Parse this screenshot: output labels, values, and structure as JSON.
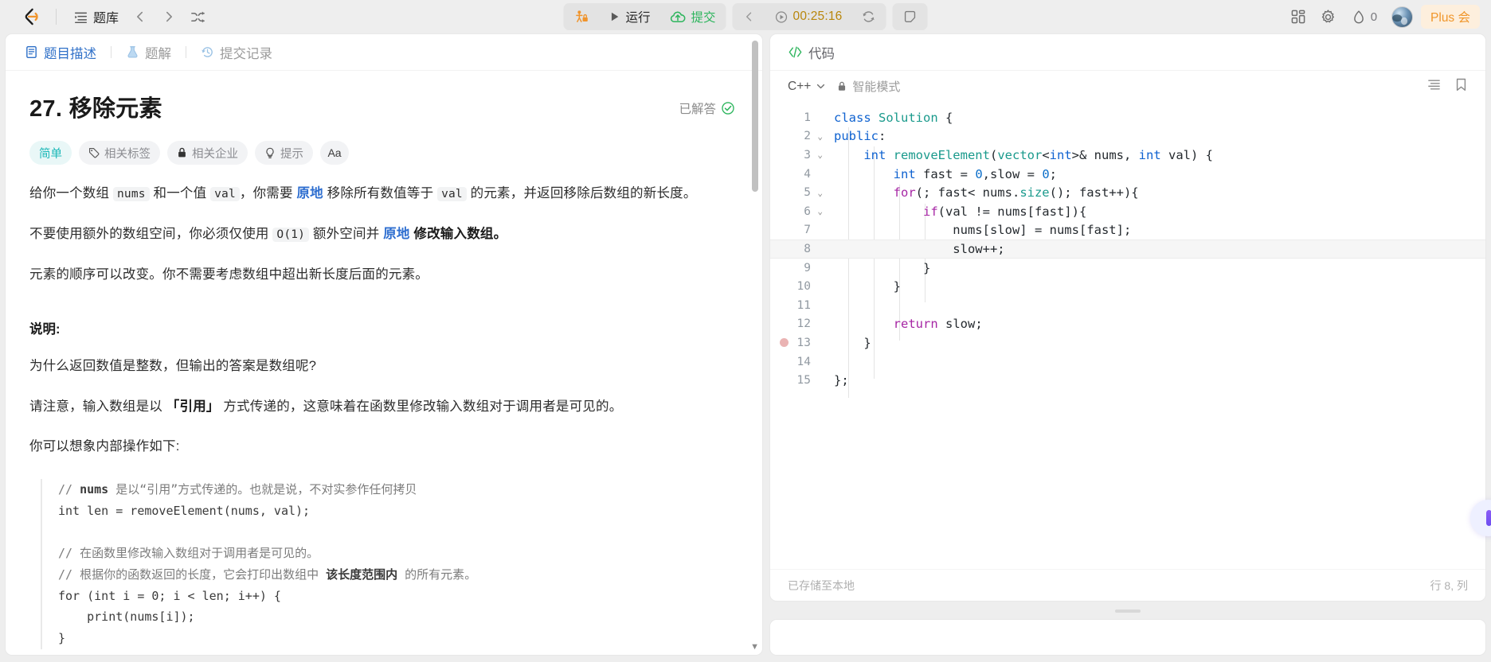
{
  "topnav": {
    "logo_name": "leetcode-logo",
    "problem_list_label": "题库",
    "back_icon": "chevron-left-icon",
    "forward_icon": "chevron-right-icon",
    "shuffle_icon": "shuffle-icon",
    "debug_label": "",
    "run_label": "运行",
    "submit_label": "提交",
    "timer_value": "00:25:16",
    "prev_icon": "chevron-left-icon",
    "play_icon": "play-circle-icon",
    "refresh_icon": "refresh-icon",
    "note_icon": "note-icon",
    "grid_icon": "grid-apps-icon",
    "settings_icon": "gear-icon",
    "streak_icon": "flame-icon",
    "streak_count": "0",
    "avatar_name": "user-avatar",
    "plus_label": "Plus 会"
  },
  "left": {
    "tabs": [
      {
        "label": "题目描述",
        "icon": "document-icon",
        "active": true
      },
      {
        "label": "题解",
        "icon": "flask-icon",
        "active": false
      },
      {
        "label": "提交记录",
        "icon": "history-icon",
        "active": false
      }
    ],
    "title": "27. 移除元素",
    "solved_label": "已解答",
    "solved_icon": "check-circle-icon",
    "pills": [
      {
        "label": "简单",
        "icon": ""
      },
      {
        "label": "相关标签",
        "icon": "tag-icon"
      },
      {
        "label": "相关企业",
        "icon": "lock-icon"
      },
      {
        "label": "提示",
        "icon": "lightbulb-icon"
      },
      {
        "label": "Aa",
        "icon": "font-size-icon"
      }
    ],
    "p1_a": "给你一个数组 ",
    "p1_code1": "nums",
    "p1_b": " 和一个值 ",
    "p1_code2": "val",
    "p1_c": "，你需要 ",
    "p1_blue": "原地",
    "p1_d": " 移除所有数值等于 ",
    "p1_code3": "val",
    "p1_e": " 的元素，并返回移除后数组的新长度。",
    "p2_a": "不要使用额外的数组空间，你必须仅使用 ",
    "p2_code": "O(1)",
    "p2_b": " 额外空间并 ",
    "p2_blue": "原地",
    "p2_bold": " 修改输入数组。",
    "p3": "元素的顺序可以改变。你不需要考虑数组中超出新长度后面的元素。",
    "section_title": "说明:",
    "p4": "为什么返回数值是整数，但输出的答案是数组呢?",
    "p5_a": "请注意，输入数组是以 ",
    "p5_bold": "「引用」",
    "p5_b": " 方式传递的，这意味着在函数里修改输入数组对于调用者是可见的。",
    "p6": "你可以想象内部操作如下:",
    "code_c1_a": "// ",
    "code_c1_b": "nums",
    "code_c1_c": " 是以“引用”方式传递的。也就是说，不对实参作任何拷贝",
    "code_l2": "int len = removeElement(nums, val);",
    "code_c3": "// 在函数里修改输入数组对于调用者是可见的。",
    "code_c4_a": "// 根据你的函数返回的长度，它会打印出数组中 ",
    "code_c4_b": "该长度范围内",
    "code_c4_c": " 的所有元素。",
    "code_l5": "for (int i = 0; i < len; i++) {",
    "code_l6": "    print(nums[i]);",
    "code_l7": "}"
  },
  "right": {
    "header_label": "代码",
    "header_icon": "code-brackets-icon",
    "language": "C++",
    "lang_chevron": "chevron-down-icon",
    "smart_mode_label": "智能模式",
    "smart_mode_icon": "lock-icon",
    "format_icon": "format-lines-icon",
    "bookmark_icon": "bookmark-icon",
    "footer_left": "已存储至本地",
    "footer_right": "行 8, 列",
    "ai_fab_icon": "ai-assistant-icon",
    "code_lines": [
      {
        "n": "1",
        "fold": "",
        "bp": false,
        "hl": false,
        "tokens": [
          {
            "t": "class ",
            "c": "k-blue"
          },
          {
            "t": "Solution",
            "c": "k-teal"
          },
          {
            "t": " {",
            "c": "k-plain"
          }
        ]
      },
      {
        "n": "2",
        "fold": "v",
        "bp": false,
        "hl": false,
        "tokens": [
          {
            "t": "public",
            "c": "k-blue"
          },
          {
            "t": ":",
            "c": "k-plain"
          }
        ]
      },
      {
        "n": "3",
        "fold": "v",
        "bp": false,
        "hl": false,
        "tokens": [
          {
            "t": "    ",
            "c": "k-plain"
          },
          {
            "t": "int ",
            "c": "k-blue"
          },
          {
            "t": "removeElement",
            "c": "k-teal"
          },
          {
            "t": "(",
            "c": "k-plain"
          },
          {
            "t": "vector",
            "c": "k-teal"
          },
          {
            "t": "<",
            "c": "k-plain"
          },
          {
            "t": "int",
            "c": "k-blue"
          },
          {
            "t": ">& nums, ",
            "c": "k-plain"
          },
          {
            "t": "int",
            "c": "k-blue"
          },
          {
            "t": " val) {",
            "c": "k-plain"
          }
        ]
      },
      {
        "n": "4",
        "fold": "",
        "bp": false,
        "hl": false,
        "tokens": [
          {
            "t": "        ",
            "c": "k-plain"
          },
          {
            "t": "int",
            "c": "k-blue"
          },
          {
            "t": " fast = ",
            "c": "k-plain"
          },
          {
            "t": "0",
            "c": "k-num"
          },
          {
            "t": ",slow = ",
            "c": "k-plain"
          },
          {
            "t": "0",
            "c": "k-num"
          },
          {
            "t": ";",
            "c": "k-plain"
          }
        ]
      },
      {
        "n": "5",
        "fold": "v",
        "bp": false,
        "hl": false,
        "tokens": [
          {
            "t": "        ",
            "c": "k-plain"
          },
          {
            "t": "for",
            "c": "k-purple"
          },
          {
            "t": "(; fast< nums.",
            "c": "k-plain"
          },
          {
            "t": "size",
            "c": "k-teal"
          },
          {
            "t": "(); fast++){",
            "c": "k-plain"
          }
        ]
      },
      {
        "n": "6",
        "fold": "v",
        "bp": false,
        "hl": false,
        "tokens": [
          {
            "t": "            ",
            "c": "k-plain"
          },
          {
            "t": "if",
            "c": "k-purple"
          },
          {
            "t": "(val != nums[fast]){",
            "c": "k-plain"
          }
        ]
      },
      {
        "n": "7",
        "fold": "",
        "bp": false,
        "hl": false,
        "tokens": [
          {
            "t": "                nums[slow] = nums[fast];",
            "c": "k-plain"
          }
        ]
      },
      {
        "n": "8",
        "fold": "",
        "bp": false,
        "hl": true,
        "tokens": [
          {
            "t": "                slow++;",
            "c": "k-plain"
          }
        ]
      },
      {
        "n": "9",
        "fold": "",
        "bp": false,
        "hl": false,
        "tokens": [
          {
            "t": "            }",
            "c": "k-plain"
          }
        ]
      },
      {
        "n": "10",
        "fold": "",
        "bp": false,
        "hl": false,
        "tokens": [
          {
            "t": "        }",
            "c": "k-plain"
          }
        ]
      },
      {
        "n": "11",
        "fold": "",
        "bp": false,
        "hl": false,
        "tokens": []
      },
      {
        "n": "12",
        "fold": "",
        "bp": false,
        "hl": false,
        "tokens": [
          {
            "t": "        ",
            "c": "k-plain"
          },
          {
            "t": "return",
            "c": "k-purple"
          },
          {
            "t": " slow;",
            "c": "k-plain"
          }
        ]
      },
      {
        "n": "13",
        "fold": "",
        "bp": true,
        "hl": false,
        "tokens": [
          {
            "t": "    }",
            "c": "k-plain"
          }
        ]
      },
      {
        "n": "14",
        "fold": "",
        "bp": false,
        "hl": false,
        "tokens": []
      },
      {
        "n": "15",
        "fold": "",
        "bp": false,
        "hl": false,
        "tokens": [
          {
            "t": "};",
            "c": "k-plain"
          }
        ]
      }
    ]
  }
}
